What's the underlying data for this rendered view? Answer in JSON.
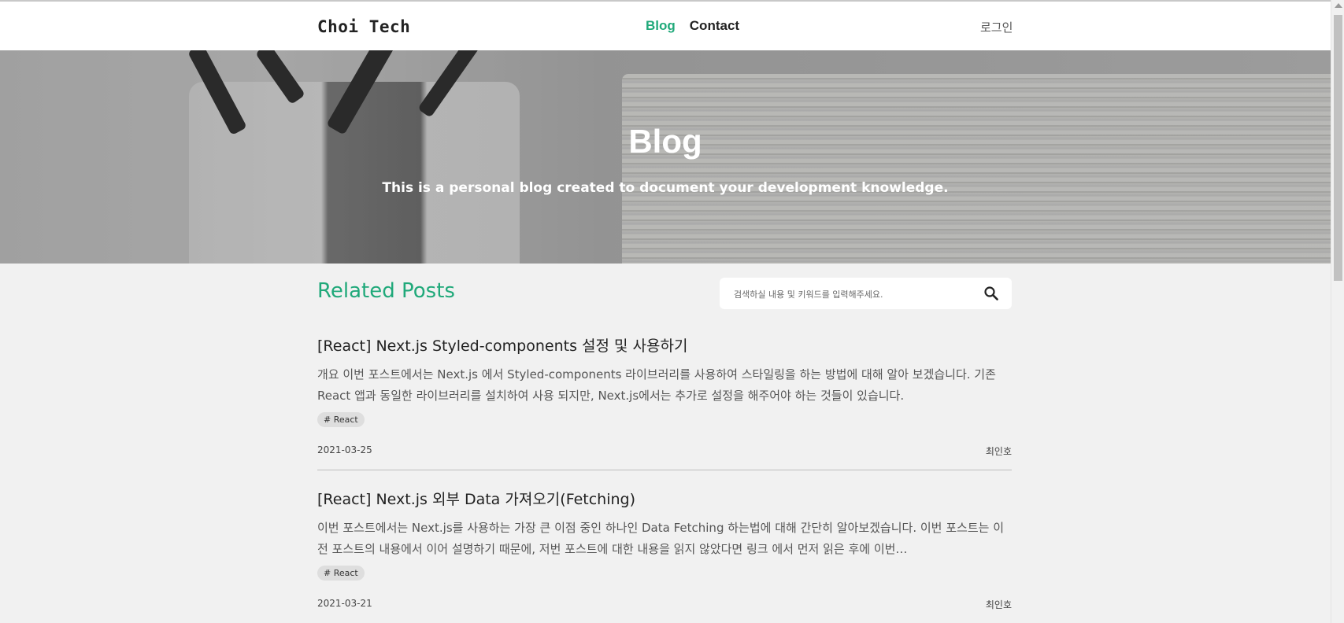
{
  "header": {
    "logo": "Choi Tech",
    "nav": {
      "blog": "Blog",
      "contact": "Contact"
    },
    "login": "로그인",
    "accent": "#20a97a"
  },
  "hero": {
    "title": "Blog",
    "subtitle": "This is a personal blog created to document your development knowledge."
  },
  "main": {
    "section_title": "Related Posts",
    "search": {
      "placeholder": "검색하실 내용 및 키워드를 입력해주세요.",
      "icon": "search-icon"
    },
    "posts": [
      {
        "title": "[React] Next.js Styled-components 설정 및 사용하기",
        "excerpt": "개요 이번 포스트에서는 Next.js 에서 Styled-components 라이브러리를 사용하여 스타일링을 하는 방법에 대해 알아 보겠습니다. 기존 React 앱과 동일한 라이브러리를 설치하여 사용 되지만, Next.js에서는 추가로 설정을 해주어야 하는 것들이 있습니다.",
        "tag": "# React",
        "date": "2021-03-25",
        "author": "최인호"
      },
      {
        "title": "[React] Next.js 외부 Data 가져오기(Fetching)",
        "excerpt": "이번 포스트에서는 Next.js를 사용하는 가장 큰 이점 중인 하나인 Data Fetching 하는법에 대해 간단히 알아보겠습니다. 이번 포스트는 이전 포스트의 내용에서 이어 설명하기 때문에, 저번 포스트에 대한 내용을 읽지 않았다면 링크 에서 먼저 읽은 후에 이번…",
        "tag": "# React",
        "date": "2021-03-21",
        "author": "최인호"
      }
    ]
  }
}
